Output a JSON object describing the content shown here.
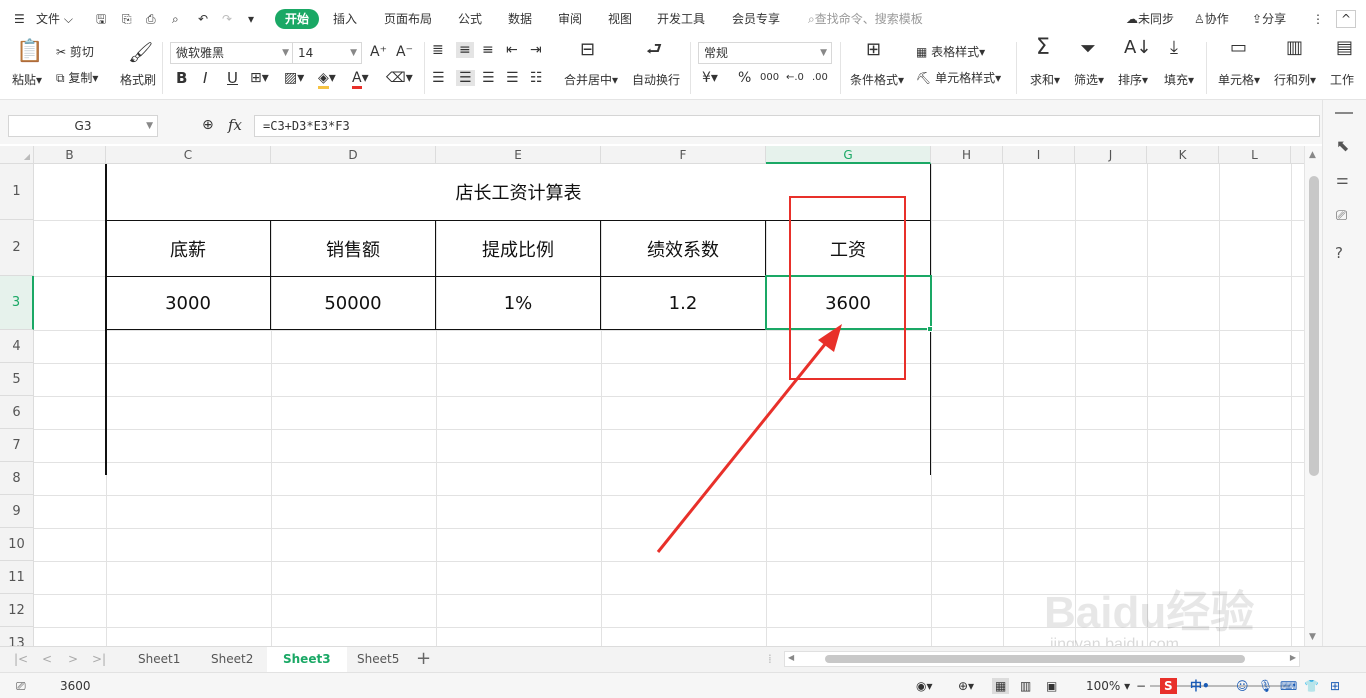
{
  "menubar": {
    "file_label": "文件",
    "tabs": [
      "开始",
      "插入",
      "页面布局",
      "公式",
      "数据",
      "审阅",
      "视图",
      "开发工具",
      "会员专享"
    ],
    "search_placeholder": "查找命令、搜索模板",
    "sync_label": "未同步",
    "collab_label": "协作",
    "share_label": "分享"
  },
  "ribbon": {
    "paste": "粘贴",
    "cut": "剪切",
    "copy": "复制",
    "format_painter": "格式刷",
    "font_name": "微软雅黑",
    "font_size": "14",
    "merge_center": "合并居中",
    "wrap_text": "自动换行",
    "number_format": "常规",
    "cond_format": "条件格式",
    "table_style": "表格样式",
    "cell_style": "单元格样式",
    "sum": "求和",
    "filter": "筛选",
    "sort": "排序",
    "fill": "填充",
    "cells": "单元格",
    "rows_cols": "行和列",
    "worksheet": "工作"
  },
  "formula": {
    "name_box": "G3",
    "fx": "fx",
    "content": "=C3+D3*E3*F3"
  },
  "columns": [
    "B",
    "C",
    "D",
    "E",
    "F",
    "G",
    "H",
    "I",
    "J",
    "K",
    "L"
  ],
  "rows": [
    "1",
    "2",
    "3",
    "4",
    "5",
    "6",
    "7",
    "8",
    "9",
    "10",
    "11",
    "12",
    "13"
  ],
  "table": {
    "title": "店长工资计算表",
    "headers": [
      "底薪",
      "销售额",
      "提成比例",
      "绩效系数",
      "工资"
    ],
    "values": [
      "3000",
      "50000",
      "1%",
      "1.2",
      "3600"
    ]
  },
  "sheets": [
    "Sheet1",
    "Sheet2",
    "Sheet3",
    "Sheet5"
  ],
  "active_sheet": "Sheet3",
  "status": {
    "value": "3600",
    "zoom": "100%"
  },
  "watermark": {
    "brand": "Baidu经验",
    "url": "jingyan.baidu.com"
  },
  "colors": {
    "accent": "#1aa865",
    "annotation": "#e8302a"
  }
}
